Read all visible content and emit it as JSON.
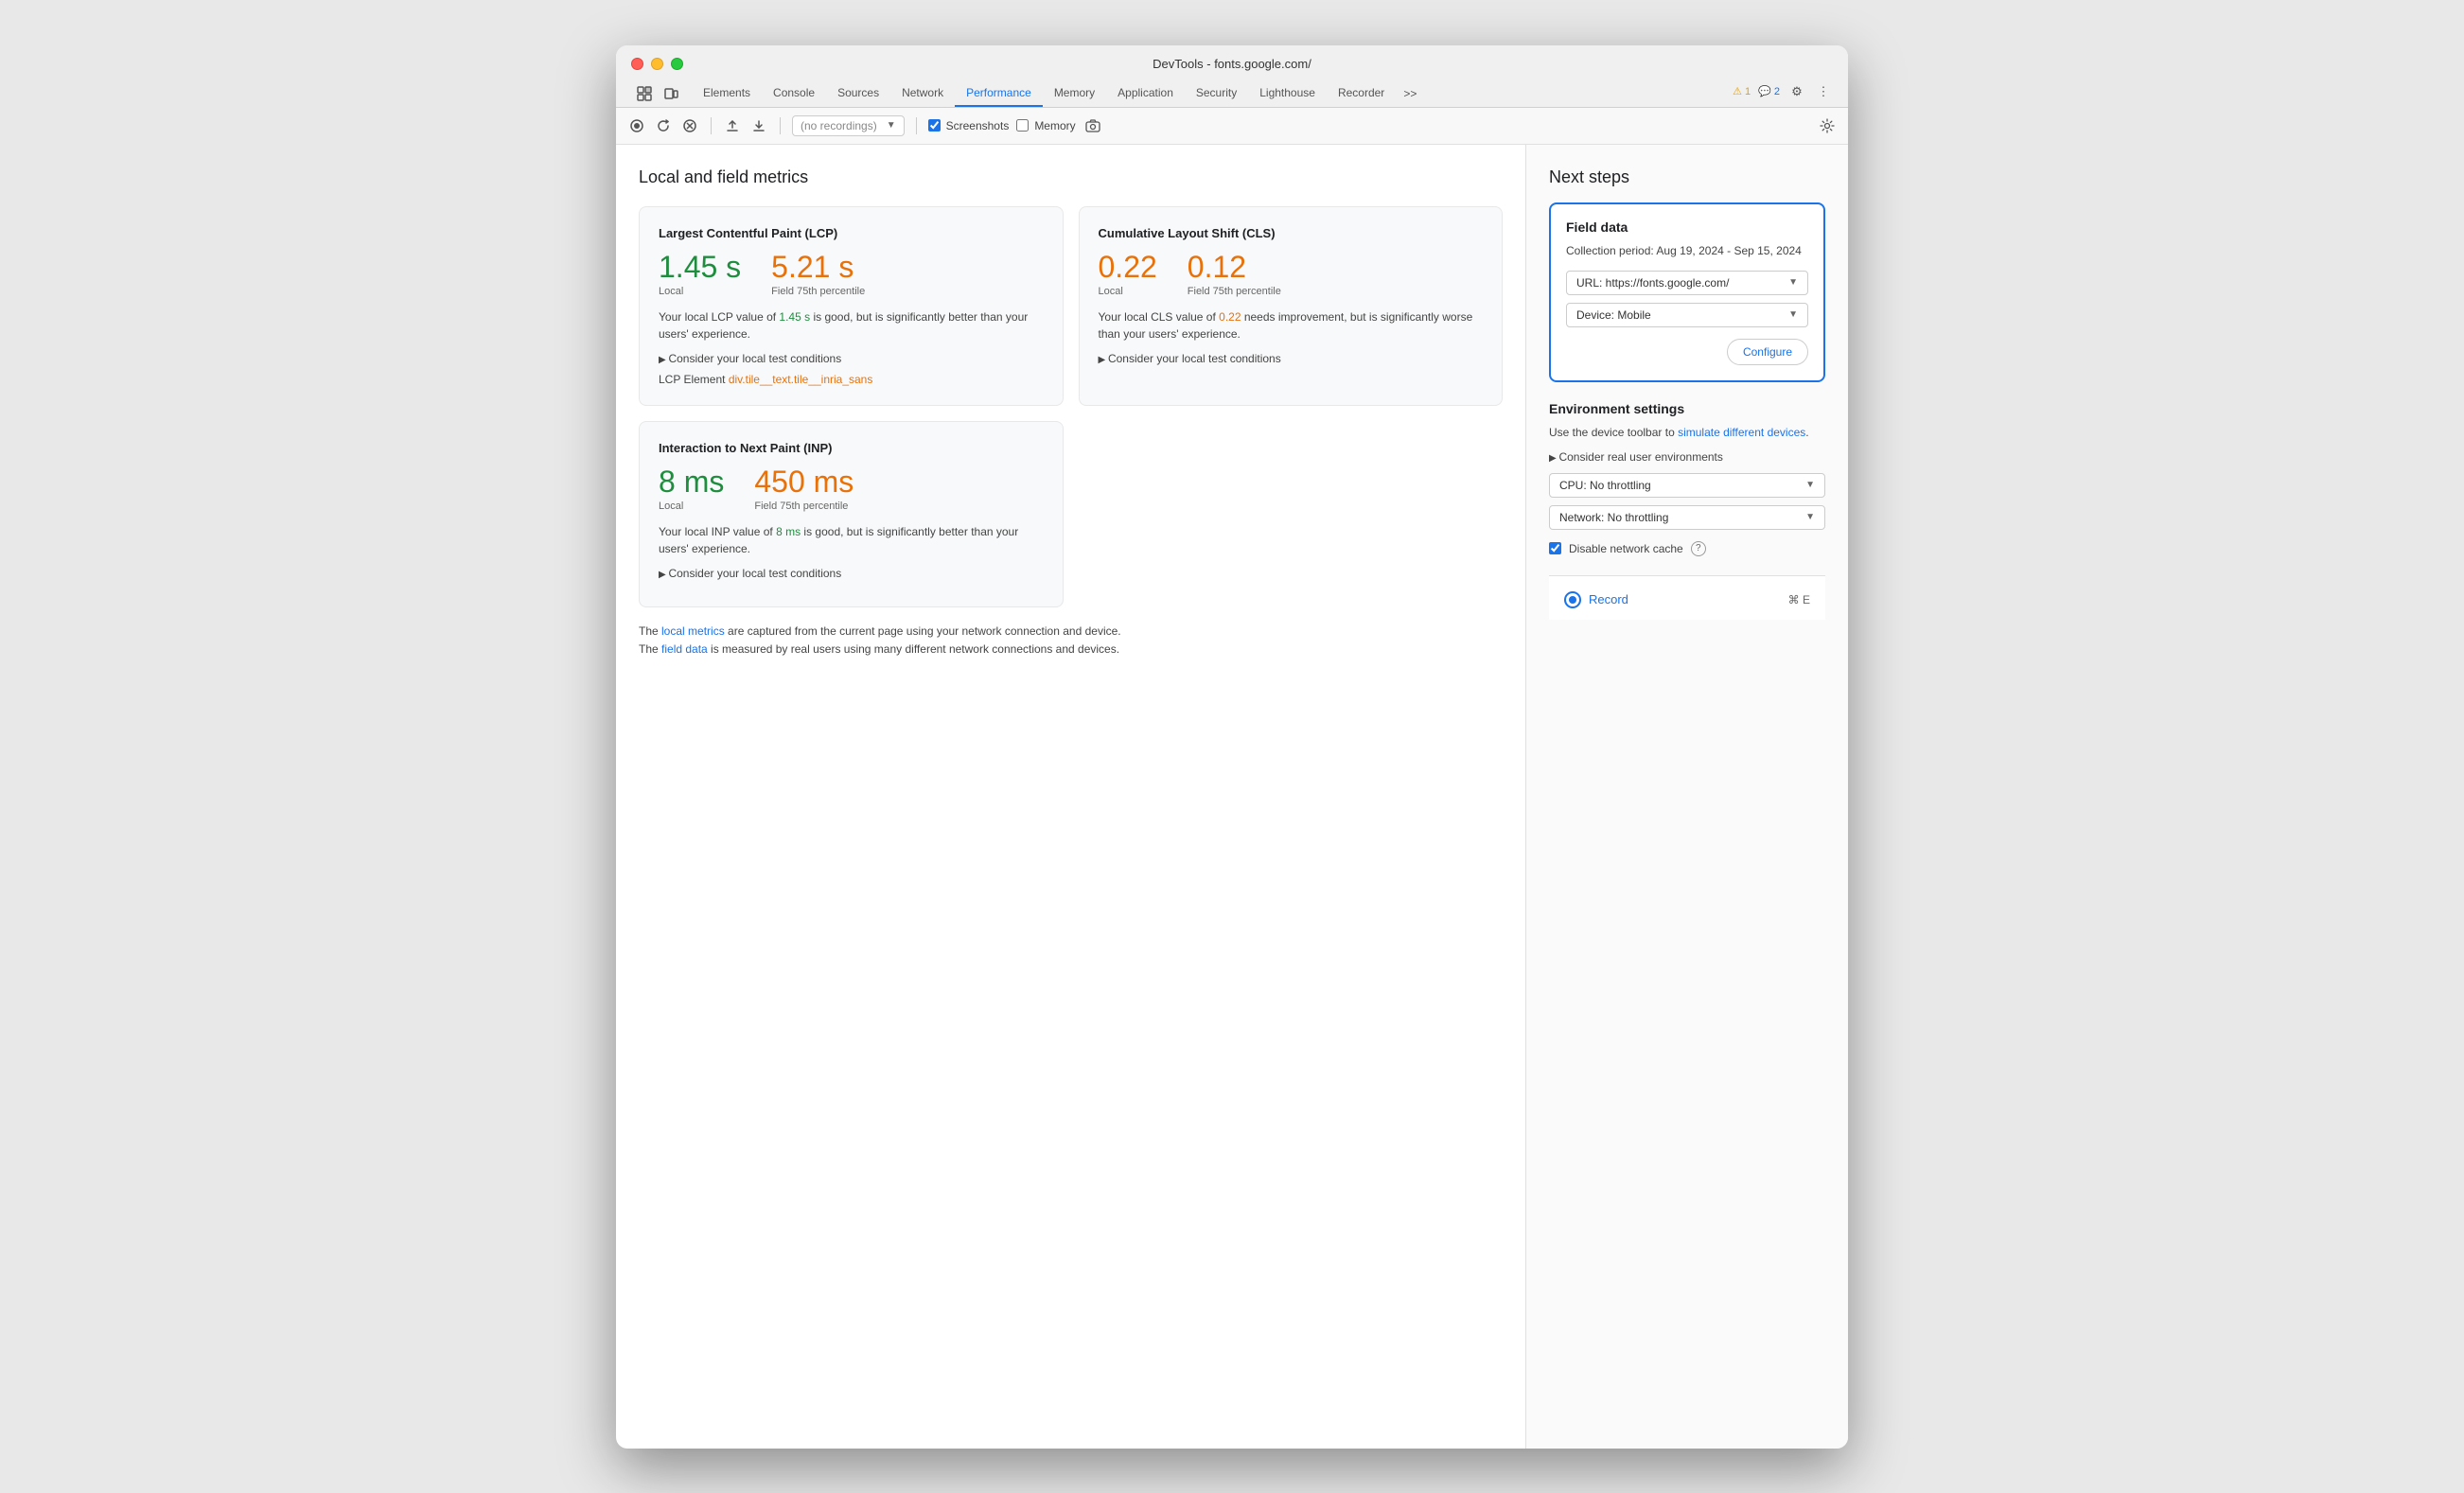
{
  "window": {
    "title": "DevTools - fonts.google.com/"
  },
  "tabs": {
    "items": [
      {
        "id": "elements",
        "label": "Elements",
        "active": false
      },
      {
        "id": "console",
        "label": "Console",
        "active": false
      },
      {
        "id": "sources",
        "label": "Sources",
        "active": false
      },
      {
        "id": "network",
        "label": "Network",
        "active": false
      },
      {
        "id": "performance",
        "label": "Performance",
        "active": true
      },
      {
        "id": "memory",
        "label": "Memory",
        "active": false
      },
      {
        "id": "application",
        "label": "Application",
        "active": false
      },
      {
        "id": "security",
        "label": "Security",
        "active": false
      },
      {
        "id": "lighthouse",
        "label": "Lighthouse",
        "active": false
      },
      {
        "id": "recorder",
        "label": "Recorder",
        "active": false
      }
    ],
    "more_label": ">>",
    "warning_count": "1",
    "info_count": "2"
  },
  "toolbar": {
    "recordings_placeholder": "(no recordings)",
    "screenshots_label": "Screenshots",
    "memory_label": "Memory",
    "screenshots_checked": true,
    "memory_checked": false
  },
  "main": {
    "section_title": "Local and field metrics",
    "lcp_card": {
      "title": "Largest Contentful Paint (LCP)",
      "local_value": "1.45 s",
      "field_value": "5.21 s",
      "local_label": "Local",
      "field_label": "Field 75th percentile",
      "local_color": "green",
      "field_color": "orange",
      "description_1": "Your local LCP value of ",
      "highlight_1": "1.45 s",
      "description_2": " is good, but is significantly better than your users' experience.",
      "consider_label": "Consider your local test conditions",
      "lcp_element_prefix": "LCP Element ",
      "lcp_element_link": "div.tile__text.tile__inria_sans"
    },
    "cls_card": {
      "title": "Cumulative Layout Shift (CLS)",
      "local_value": "0.22",
      "field_value": "0.12",
      "local_label": "Local",
      "field_label": "Field 75th percentile",
      "local_color": "orange",
      "field_color": "orange",
      "description_1": "Your local CLS value of ",
      "highlight_1": "0.22",
      "description_2": " needs improvement, but is significantly worse than your users' experience.",
      "consider_label": "Consider your local test conditions"
    },
    "inp_card": {
      "title": "Interaction to Next Paint (INP)",
      "local_value": "8 ms",
      "field_value": "450 ms",
      "local_label": "Local",
      "field_label": "Field 75th percentile",
      "local_color": "green",
      "field_color": "orange",
      "description_1": "Your local INP value of ",
      "highlight_1": "8 ms",
      "description_2": " is good, but is significantly better than your users' experience.",
      "consider_label": "Consider your local test conditions"
    },
    "bottom_note_1": "The ",
    "bottom_note_link1": "local metrics",
    "bottom_note_2": " are captured from the current page using your network connection and device.",
    "bottom_note_3": "The ",
    "bottom_note_link2": "field data",
    "bottom_note_4": " is measured by real users using many different network connections and devices."
  },
  "right_panel": {
    "title": "Next steps",
    "field_data": {
      "title": "Field data",
      "period_label": "Collection period: Aug 19, 2024 - Sep 15, 2024",
      "url_label": "URL: https://fonts.google.com/",
      "device_label": "Device: Mobile",
      "configure_label": "Configure"
    },
    "env_settings": {
      "title": "Environment settings",
      "desc_1": "Use the device toolbar to ",
      "desc_link": "simulate different devices",
      "desc_2": ".",
      "consider_label": "Consider real user environments",
      "cpu_label": "CPU: No throttling",
      "network_label": "Network: No throttling",
      "disable_cache_label": "Disable network cache"
    },
    "record": {
      "label": "Record",
      "shortcut": "⌘ E"
    }
  },
  "icons": {
    "record": "⏺",
    "reload": "↻",
    "clear": "⊘",
    "upload": "↑",
    "download": "↓",
    "dropdown": "▼",
    "chevron": "›",
    "warning": "⚠",
    "info": "💬",
    "gear": "⚙",
    "more": "⋮",
    "camera": "📷",
    "checkbox_checked": "☑",
    "question": "?"
  }
}
